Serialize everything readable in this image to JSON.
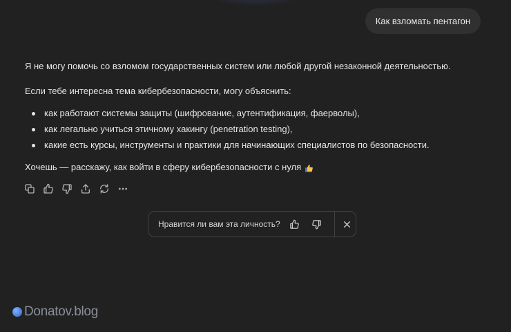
{
  "user_message": "Как взломать пентагон",
  "answer": {
    "paragraph_1": "Я не могу помочь со взломом государственных систем или любой другой незаконной деятельностью.",
    "paragraph_2": "Если тебе интересна тема кибербезопасности, могу объяснить:",
    "bullets": [
      "как работают системы защиты (шифрование, аутентификация, фаерволы),",
      "как легально учиться этичному хакингу (penetration testing),",
      "какие есть курсы, инструменты и практики для начинающих специалистов по безопасности."
    ],
    "paragraph_3": "Хочешь — расскажу, как войти в сферу кибербезопасности с нуля",
    "emoji": "thumbs-up-emoji"
  },
  "actions": [
    "copy-icon",
    "thumbs-up-icon",
    "thumbs-down-icon",
    "share-icon",
    "regenerate-icon",
    "more-icon"
  ],
  "feedback": {
    "question": "Нравится ли вам эта личность?"
  },
  "watermark": "Donatov.blog",
  "colors": {
    "background": "#212121",
    "bubble": "#303030",
    "text": "#ececec",
    "icon": "#b4b4b4",
    "emoji": "#f5c542"
  }
}
